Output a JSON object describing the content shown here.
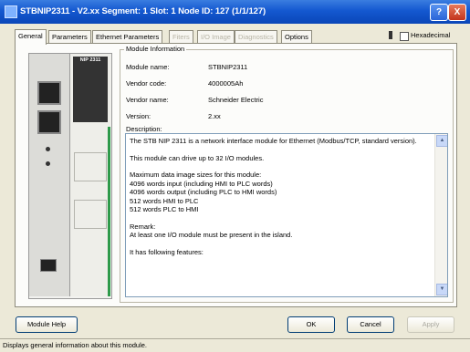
{
  "window": {
    "title": "STBNIP2311 - V2.xx Segment: 1 Slot: 1 Node ID: 127 (1/1/127)",
    "help_button": "?",
    "close_button": "X"
  },
  "tabs": [
    {
      "label": "General",
      "state": "active"
    },
    {
      "label": "Parameters",
      "state": "enabled"
    },
    {
      "label": "Ethernet Parameters",
      "state": "enabled"
    },
    {
      "label": "Fiters",
      "state": "disabled"
    },
    {
      "label": "I/O Image",
      "state": "disabled"
    },
    {
      "label": "Diagnostics",
      "state": "disabled"
    },
    {
      "label": "Options",
      "state": "enabled"
    }
  ],
  "hexadecimal": {
    "label": "Hexadecimal",
    "checked": false
  },
  "module_image": {
    "label": "NIP 2311"
  },
  "module_info": {
    "group_title": "Module Information",
    "fields": [
      {
        "label": "Module name:",
        "value": "STBNIP2311"
      },
      {
        "label": "Vendor code:",
        "value": "4000005Ah"
      },
      {
        "label": "Vendor name:",
        "value": "Schneider Electric"
      },
      {
        "label": "Version:",
        "value": "2.xx"
      }
    ],
    "description_label": "Description:",
    "description": [
      "The STB NIP 2311 is a network interface module for Ethernet (Modbus/TCP, standard version).",
      "This module can drive up to 32 I/O modules.",
      "Maximum data image sizes for this module:\n 4096 words input (including HMI to PLC words)\n 4096 words output (including PLC to HMI words)\n 512 words HMI to PLC\n 512 words PLC to HMI",
      "Remark:\nAt least one I/O module must be present in the island.",
      "It has following features:"
    ]
  },
  "buttons": {
    "module_help": "Module Help",
    "ok": "OK",
    "cancel": "Cancel",
    "apply": "Apply"
  },
  "status_bar": "Displays general information about this module."
}
